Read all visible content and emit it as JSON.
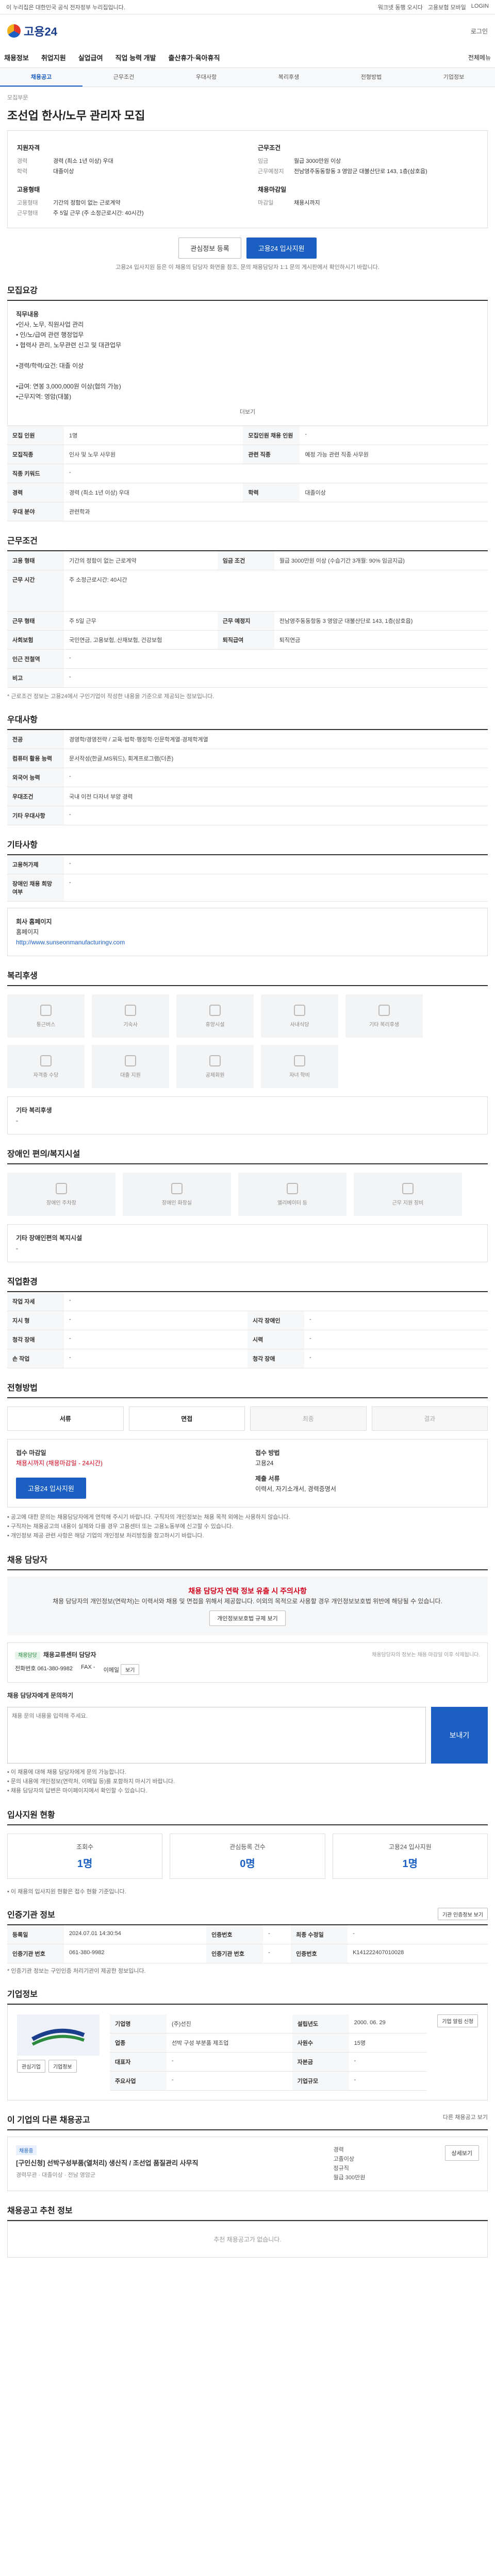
{
  "topbar": {
    "left": "이 누리집은 대한민국 공식 전자정부 누리집입니다.",
    "links": [
      "워크넷 동행 오시다",
      "고용보험 모바일",
      "LOGIN"
    ]
  },
  "header": {
    "logo_text": "고용24",
    "login": "로그인"
  },
  "gnb": {
    "items": [
      "채용정보",
      "취업지원",
      "실업급여",
      "직업 능력 개발",
      "출산휴가·육아휴직"
    ],
    "all": "전체메뉴"
  },
  "subtabs": [
    "채용공고",
    "근무조건",
    "우대사항",
    "복리후생",
    "전형방법",
    "기업정보"
  ],
  "crumb": "모집부문",
  "title": "조선업 한사/노무 관리자 모집",
  "summary": {
    "left_heading": "지원자격",
    "left": [
      {
        "k": "경력",
        "v": "경력 (최소 1년 이상) 우대"
      },
      {
        "k": "학력",
        "v": "대졸이상"
      }
    ],
    "left_heading2": "고용형태",
    "left2": [
      {
        "k": "고용형태",
        "v": "기간의 정함이 없는 근로계약"
      },
      {
        "k": "근무형태",
        "v": "주 5일 근무 (주 소정근로시간: 40시간)"
      }
    ],
    "right_heading": "근무조건",
    "right": [
      {
        "k": "임금",
        "v": "월급 3000만원 이상"
      },
      {
        "k": "근무예정지",
        "v": "전남영주동동항동 3 영암군 대불산단로 143, 1층(삼호읍)"
      }
    ],
    "right_heading2": "채용마감일",
    "right2": [
      {
        "k": "마감일",
        "v": "채용시까지"
      }
    ]
  },
  "actions": {
    "save": "관심정보 등록",
    "apply": "고용24 입사지원"
  },
  "apply_note": "고용24 입사지원 등은 이 채용의 담당자 화면을 참조, 문의 채용담당자 1:1 문의 게시판에서 확인하시기 바랍니다.",
  "sec1": {
    "title": "모집요강",
    "job_heading": "직무내용",
    "job_lines": [
      "•인사, 노무, 직원사업 관리",
      "• 인/노/급여 관련 행정업무",
      "• 협력사 관리, 노무관련 신고 및 대관업무",
      "",
      "•경력/학력/요건: 대졸 이상",
      "",
      "•급여: 연봉 3,000,000원 이상(협의 가능)",
      "•근무지역: 영암(대불)"
    ],
    "more": "더보기",
    "rows": [
      {
        "k": "모집 인원",
        "v": "1명",
        "k2": "모집인원 채용 인원",
        "v2": "-"
      },
      {
        "k": "모집직종",
        "v": "인사 및 노무 사무원",
        "k2": "관련 직종",
        "v2": "예정 가능 관련 직종 사무원"
      },
      {
        "k": "직종 키워드",
        "v": "-",
        "k2": "",
        "v2": ""
      },
      {
        "k": "경력",
        "v": "경력 (최소 1년 이상) 우대",
        "k2": "학력",
        "v2": "대졸이상"
      },
      {
        "k": "우대 분야",
        "v": "관련학과",
        "k2": "",
        "v2": ""
      }
    ]
  },
  "sec2": {
    "title": "근무조건",
    "rows": [
      {
        "k": "고용 형태",
        "v": "기간의 정함이 없는 근로계약",
        "k2": "임금 조건",
        "v2": "월급 3000만원 이상 (수습기간 3개월: 90% 임금지급)"
      },
      {
        "k": "근무 시간",
        "v": "주 소정근로시간: 40시간",
        "k2": "",
        "v2": ""
      },
      {
        "k": "근무 형태",
        "v": "주 5일 근무",
        "k2": "근무 예정지",
        "v2": "전남영주동동항동 3 영암군 대불산단로 143, 1층(삼호읍)"
      },
      {
        "k": "사회보험",
        "v": "국민연금, 고용보험, 산재보험, 건강보험",
        "k2": "퇴직급여",
        "v2": "퇴직연금"
      },
      {
        "k": "인근 전철역",
        "v": "-",
        "k2": "",
        "v2": ""
      },
      {
        "k": "비고",
        "v": "-",
        "k2": "",
        "v2": ""
      }
    ],
    "note": "* 근로조건 정보는 고용24에서 구인기업이 작성한 내용을 기준으로 제공되는 정보입니다."
  },
  "sec3": {
    "title": "우대사항",
    "rows": [
      {
        "k": "전공",
        "v": "경영학/경영전략 / 교육·법학·행정학·인문학계열·경제학계열"
      },
      {
        "k": "컴퓨터 활용 능력",
        "v": "문서작성(한글,MS워드), 회계프로그램(더존)"
      },
      {
        "k": "외국어 능력",
        "v": "-"
      },
      {
        "k": "우대조건",
        "v": "국내 이전 다자녀 부양 경력"
      },
      {
        "k": "기타 우대사항",
        "v": "-"
      }
    ]
  },
  "sec4": {
    "title": "기타사항",
    "rows": [
      {
        "k": "고용허가제",
        "v": "-"
      },
      {
        "k": "장애인 채용 희망 여부",
        "v": "-"
      }
    ],
    "homepage_label": "회사 홈페이지",
    "homepage_sub": "홈페이지",
    "homepage_url": "http://www.sunseonmanufacturingv.com"
  },
  "sec5": {
    "title": "복리후생",
    "cards": [
      "통근버스",
      "기숙사",
      "휴양시설",
      "사내식당",
      "기타 복리후생",
      "자격증 수당",
      "대출 지원",
      "공제회원",
      "자녀 학비"
    ],
    "etc_title": "기타 복리후생",
    "etc_value": "-"
  },
  "sec6": {
    "title": "장애인 편의/복지시설",
    "cards": [
      "장애인 주차장",
      "장애인 화장실",
      "엘리베이터 등",
      "근무 지원 장비"
    ],
    "etc_title": "기타 장애인편의 복지시설",
    "etc_value": "-"
  },
  "sec7": {
    "title": "직업환경",
    "rows": [
      {
        "k": "작업 자세",
        "v": "-"
      },
      {
        "k": "지시 형",
        "v": "-",
        "k2": "시각 장애인",
        "v2": "-"
      },
      {
        "k": "청각 장애",
        "v": "-",
        "k2": "시력",
        "v2": "-"
      },
      {
        "k": "손 작업",
        "v": "-",
        "k2": "청각 장애",
        "v2": "-"
      }
    ]
  },
  "sec8": {
    "title": "전형방법",
    "steps": [
      "서류",
      "면접",
      "최종",
      "결과"
    ],
    "apply_method_title": "접수 마감일",
    "apply_deadline": "채용시까지 (채용마감일 - 24시간)",
    "apply_way_title": "접수 방법",
    "apply_way": "고용24",
    "docs_title": "제출 서류",
    "docs": "이력서, 자기소개서, 경력증명서",
    "apply_btn": "고용24 입사지원",
    "notes": [
      "• 공고에 대한 문의는 채용담당자에게 연락해 주시기 바랍니다. 구직자의 개인정보는 채용 목적 외에는 사용하지 않습니다.",
      "• 구직자는 채용공고의 내용이 실제와 다를 경우 고용센터 또는 고용노동부에 신고할 수 있습니다.",
      "• 개인정보 제공 관련 사항은 해당 기업의 개인정보 처리방침을 참고하시기 바랍니다."
    ]
  },
  "sec9": {
    "title": "채용 담당자",
    "warn": "채용 담당자 연락 정보 유출 시 주의사항",
    "warn_body": "채용 담당자의 개인정보(연락처)는 이력서와 채용 및 면접을 위해서 제공합니다. 이외의 목적으로 사용할 경우 개인정보보호법 위반에 해당될 수 있습니다.",
    "warn_btn": "개인정보보호법 규제 보기",
    "mgr_label": "채용담당",
    "mgr_name": "채용교류센터 담당자",
    "mgr_note": "채용담당자의 정보는 채용 마감일 이후 삭제됩니다.",
    "phone_label": "전화번호",
    "phone": "061-380-9982",
    "fax_label": "FAX",
    "fax": "-",
    "email_label": "이메일",
    "email_btn": "보기",
    "inquiry_title": "채용 담당자에게 문의하기",
    "inquiry_placeholder": "채용 문의 내용을 입력해 주세요.",
    "send": "보내기",
    "inq_notes": [
      "• 이 채용에 대해 채용 담당자에게 문의 가능합니다.",
      "• 문의 내용에 개인정보(연락처, 이메일 등)를 포함하지 마시기 바랍니다.",
      "• 채용 담당자의 답변은 마이페이지에서 확인할 수 있습니다."
    ],
    "inq_btn": "채용 문의하기"
  },
  "sec10": {
    "title": "입사지원 현황",
    "stats": [
      {
        "label": "조회수",
        "value": "1명"
      },
      {
        "label": "관심등록 건수",
        "value": "0명"
      },
      {
        "label": "고용24 입사지원",
        "value": "1명"
      }
    ],
    "note": "• 이 채용의 입사지원 현황은 접수 현황 기준입니다."
  },
  "sec11": {
    "title": "인증기관 정보",
    "btn": "기관 인증정보 보기",
    "rows": [
      {
        "k": "등록일",
        "v": "2024.07.01 14:30:54",
        "k2": "인증번호",
        "v2": "-",
        "k3": "최종 수정일",
        "v3": "-"
      },
      {
        "k": "인증기관 번호",
        "v": "061-380-9982",
        "k2": "인증기관 번호",
        "v2": "-",
        "k3": "인증번호",
        "v3": "K141222407010028"
      }
    ],
    "note": "* 인증기관 정보는 구인인증 처리기관이 제공한 정보입니다."
  },
  "sec12": {
    "title": "기업정보",
    "rows": [
      {
        "k": "기업명",
        "v": "(주)선진",
        "k2": "설립년도",
        "v2": "2000. 06. 29"
      },
      {
        "k": "업종",
        "v": "선박 구성 부분품 제조업",
        "k2": "사원수",
        "v2": "15명"
      },
      {
        "k": "대표자",
        "v": "-",
        "k2": "자본금",
        "v2": "-"
      },
      {
        "k": "주요사업",
        "v": "-",
        "k2": "기업규모",
        "v2": "-"
      }
    ],
    "btn1": "관심기업",
    "btn2": "기업정보",
    "follow": "기업 알림 신청"
  },
  "sec13": {
    "title": "이 기업의 다른 채용공고",
    "more": "다른 채용공고 보기",
    "tag": "채용중",
    "job_title": "[구인신청] 선박구성부품(열처리) 생산직 / 조선업 품질관리 사무직",
    "meta": "경력무관 · 대졸이상 · 전남 영암군",
    "side": [
      "경력",
      "고졸이상",
      "정규직",
      "월급 300만원"
    ],
    "btn": "상세보기"
  },
  "sec14": {
    "title": "채용공고 추천 정보",
    "empty": "추천 채용공고가 없습니다."
  }
}
